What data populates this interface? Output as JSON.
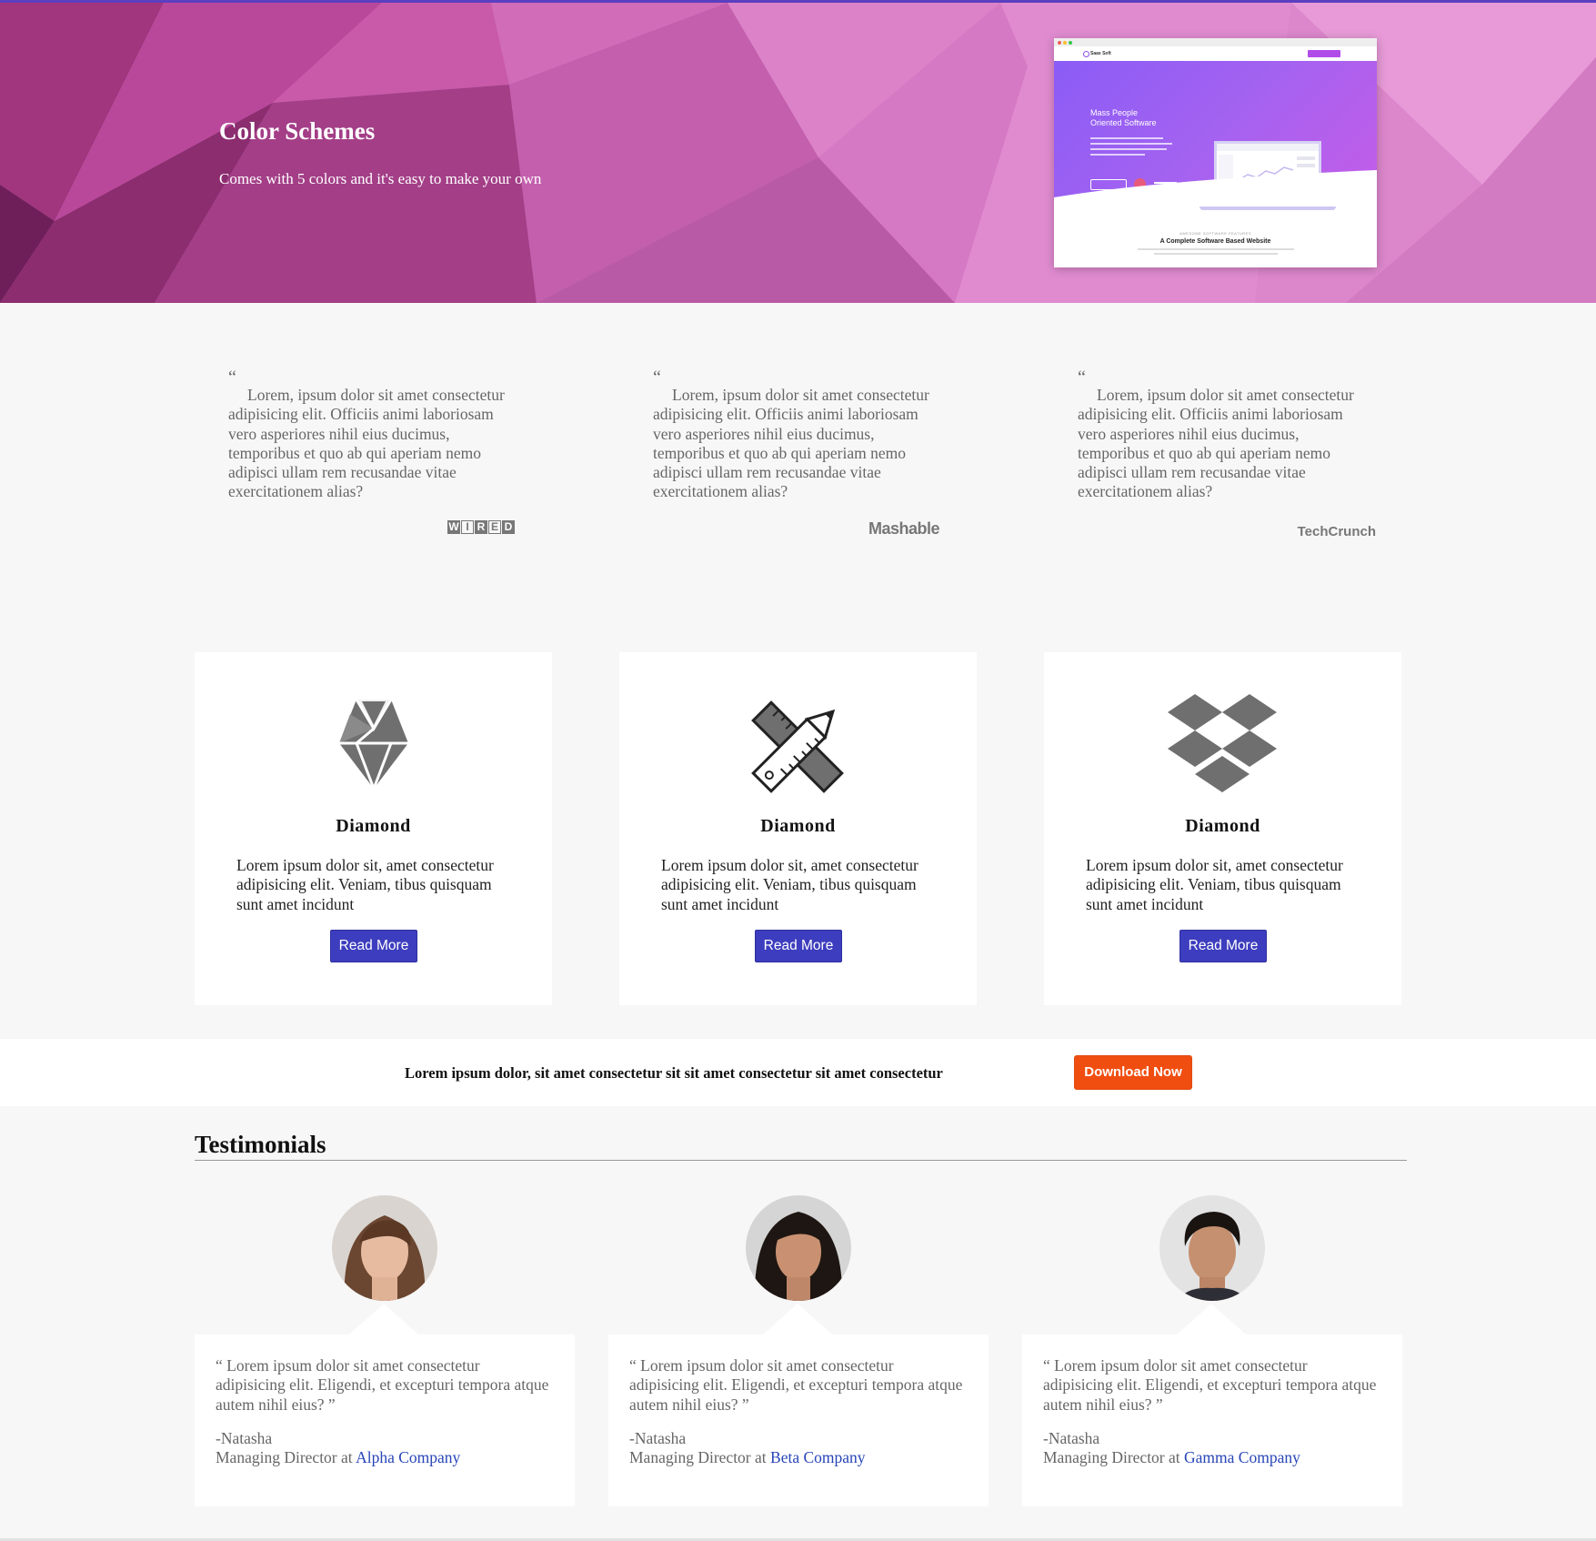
{
  "hero": {
    "title": "Color Schemes",
    "subtitle": "Comes with 5 colors and it's easy to make your own",
    "preview": {
      "logo": "Saas Soft",
      "headline_line1": "Mass People",
      "headline_line2": "Oriented Software",
      "section_tag": "AWESOME SOFTWARE FEATURES",
      "section_title": "A Complete Software Based Website"
    }
  },
  "press": [
    {
      "mark": "“",
      "quote": "Lorem, ipsum dolor sit amet consectetur adipisicing elit. Officiis animi laboriosam vero asperiores nihil eius ducimus, temporibus et quo ab qui aperiam nemo adipisci ullam rem recusandae vitae exercitationem alias?",
      "logo": "WIRED"
    },
    {
      "mark": "“",
      "quote": "Lorem, ipsum dolor sit amet consectetur adipisicing elit. Officiis animi laboriosam vero asperiores nihil eius ducimus, temporibus et quo ab qui aperiam nemo adipisci ullam rem recusandae vitae exercitationem alias?",
      "logo": "Mashable"
    },
    {
      "mark": "“",
      "quote": "Lorem, ipsum dolor sit amet consectetur adipisicing elit. Officiis animi laboriosam vero asperiores nihil eius ducimus, temporibus et quo ab qui aperiam nemo adipisci ullam rem recusandae vitae exercitationem alias?",
      "logo": "TechCrunch"
    }
  ],
  "features": [
    {
      "icon": "diamond-icon",
      "title": "Diamond",
      "text": "Lorem ipsum dolor sit, amet consectetur adipisicing elit. Veniam, tibus quisquam sunt amet incidunt",
      "button": "Read More"
    },
    {
      "icon": "ruler-pencil-icon",
      "title": "Diamond",
      "text": "Lorem ipsum dolor sit, amet consectetur adipisicing elit. Veniam, tibus quisquam sunt amet incidunt",
      "button": "Read More"
    },
    {
      "icon": "dropbox-icon",
      "title": "Diamond",
      "text": "Lorem ipsum dolor sit, amet consectetur adipisicing elit. Veniam, tibus quisquam sunt amet incidunt",
      "button": "Read More"
    }
  ],
  "cta": {
    "text": "Lorem ipsum dolor, sit amet consectetur sit sit amet consectetur sit amet consectetur",
    "button": "Download Now"
  },
  "testimonials": {
    "heading": "Testimonials",
    "items": [
      {
        "quote": "“ Lorem ipsum dolor sit amet consectetur adipisicing elit. Eligendi, et excepturi tempora atque autem nihil eius? ”",
        "name": "-Natasha",
        "role": "Managing Director at ",
        "company": "Alpha Company"
      },
      {
        "quote": "“ Lorem ipsum dolor sit amet consectetur adipisicing elit. Eligendi, et excepturi tempora atque autem nihil eius? ”",
        "name": "-Natasha",
        "role": "Managing Director at ",
        "company": "Beta Company"
      },
      {
        "quote": "“ Lorem ipsum dolor sit amet consectetur adipisicing elit. Eligendi, et excepturi tempora atque autem nihil eius? ”",
        "name": "-Natasha",
        "role": "Managing Director at ",
        "company": "Gamma Company"
      }
    ]
  },
  "colors": {
    "accent_top": "#5a3fc0",
    "button_primary": "#3d3dbf",
    "button_cta": "#f04e10",
    "link": "#2845b8"
  }
}
